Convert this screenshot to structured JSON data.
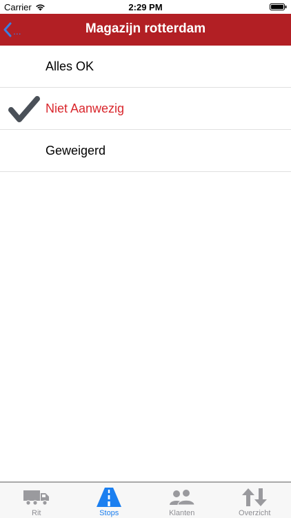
{
  "status_bar": {
    "carrier": "Carrier",
    "time": "2:29 PM",
    "wifi_icon": "wifi-icon",
    "battery_icon": "battery-icon"
  },
  "nav": {
    "back_label": "...",
    "title": "Magazijn rotterdam",
    "bar_color": "#b21f24",
    "back_color": "#3b7de1"
  },
  "list": {
    "items": [
      {
        "label": "Alles OK",
        "selected": false
      },
      {
        "label": "Niet Aanwezig",
        "selected": true
      },
      {
        "label": "Geweigerd",
        "selected": false
      }
    ],
    "selected_color": "#d9262c",
    "check_icon": "checkmark-icon"
  },
  "tabs": {
    "items": [
      {
        "label": "Rit",
        "icon": "truck-icon",
        "active": false
      },
      {
        "label": "Stops",
        "icon": "road-icon",
        "active": true
      },
      {
        "label": "Klanten",
        "icon": "users-icon",
        "active": false
      },
      {
        "label": "Overzicht",
        "icon": "up-down-arrows-icon",
        "active": false
      }
    ],
    "active_color": "#1b7ff0",
    "inactive_color": "#8e8e93"
  }
}
